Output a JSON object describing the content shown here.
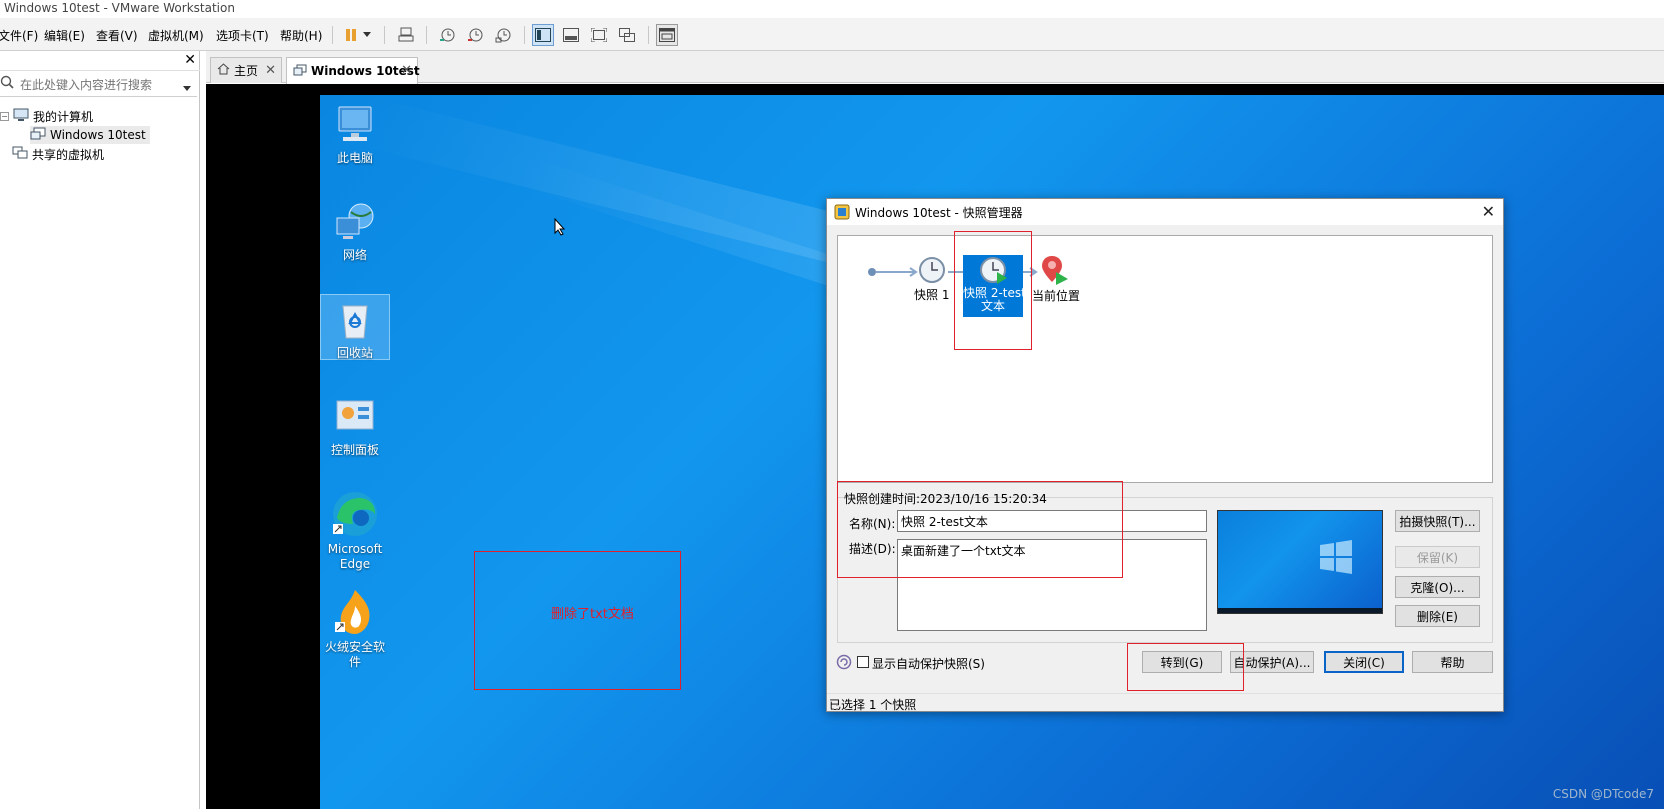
{
  "window": {
    "title": "Windows 10test - VMware Workstation"
  },
  "menu": [
    "文件(F)",
    "编辑(E)",
    "查看(V)",
    "虚拟机(M)",
    "选项卡(T)",
    "帮助(H)"
  ],
  "library": {
    "search_placeholder": "在此处键入内容进行搜索",
    "tree": {
      "root": "我的计算机",
      "vm": "Windows 10test",
      "shared": "共享的虚拟机"
    }
  },
  "tabs": [
    {
      "label": "主页"
    },
    {
      "label": "Windows 10test"
    }
  ],
  "desktop": {
    "icons": [
      {
        "label": "此电脑"
      },
      {
        "label": "网络"
      },
      {
        "label": "回收站"
      },
      {
        "label": "控制面板"
      },
      {
        "label": "Microsoft Edge"
      },
      {
        "label": "火绒安全软件"
      }
    ],
    "annotation": "删除了txt文档"
  },
  "dialog": {
    "title": "Windows 10test - 快照管理器",
    "tree": {
      "snapshot1": "快照 1",
      "snapshot2_line1": "快照 2-test",
      "snapshot2_line2": "文本",
      "current": "当前位置"
    },
    "created": "快照创建时间:2023/10/16 15:20:34",
    "name_label": "名称(N):",
    "name_value": "快照 2-test文本",
    "desc_label": "描述(D):",
    "desc_value": "桌面新建了一个txt文本",
    "buttons": {
      "take": "拍摄快照(T)...",
      "keep": "保留(K)",
      "clone": "克隆(O)...",
      "delete": "删除(E)",
      "goto": "转到(G)",
      "autoprotect": "自动保护(A)...",
      "close": "关闭(C)",
      "help": "帮助"
    },
    "show_autoprotect": "显示自动保护快照(S)",
    "status": "已选择 1 个快照"
  },
  "watermark": "CSDN @DTcode7",
  "colors": {
    "accent": "#0a64c8",
    "selection": "#0078d7",
    "annotation": "#e0202a"
  }
}
